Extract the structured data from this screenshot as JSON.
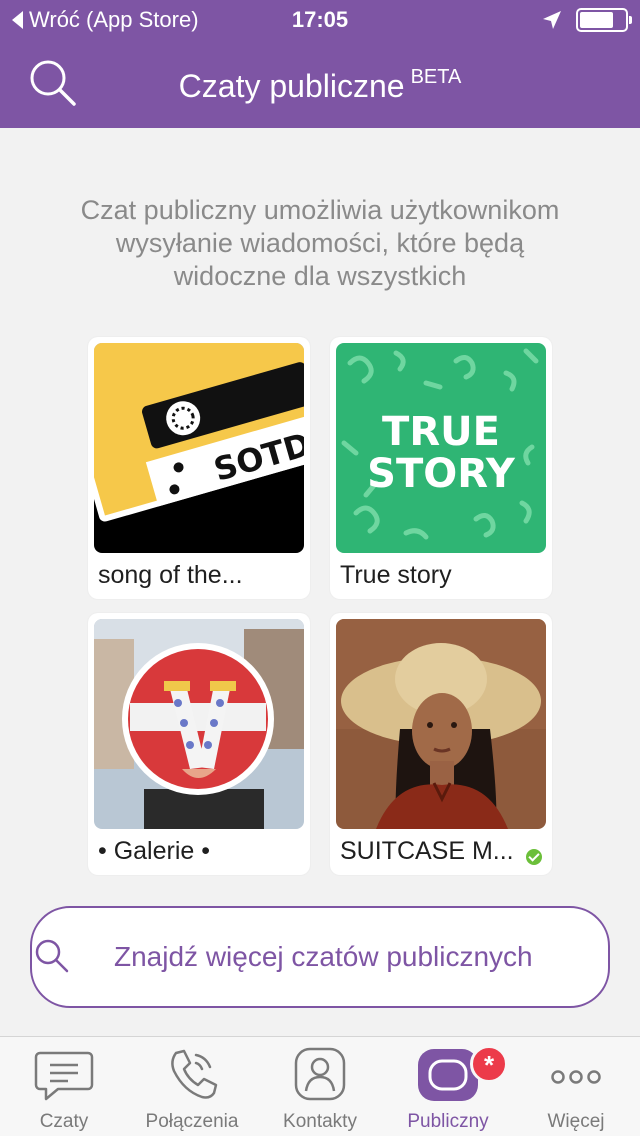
{
  "status": {
    "back_label": "Wróć (App Store)",
    "time": "17:05",
    "battery_level": 0.75
  },
  "header": {
    "title": "Czaty publiczne",
    "beta": "BETA"
  },
  "description": "Czat publiczny umożliwia użytkownikom wysyłanie wiadomości, które będą widoczne dla wszystkich",
  "cards": [
    {
      "label": "song of the...",
      "image_text": "SOTD",
      "verified": false
    },
    {
      "label": "True story",
      "image_text_1": "TRUE",
      "image_text_2": "STORY",
      "verified": false
    },
    {
      "label": "• Galerie •",
      "verified": false
    },
    {
      "label": "SUITCASE M...",
      "verified": true
    }
  ],
  "find_more": {
    "label": "Znajdź więcej czatów publicznych"
  },
  "tabs": [
    {
      "label": "Czaty",
      "icon": "chat-bubble-icon"
    },
    {
      "label": "Połączenia",
      "icon": "phone-icon"
    },
    {
      "label": "Kontakty",
      "icon": "contacts-icon"
    },
    {
      "label": "Publiczny",
      "icon": "public-chat-icon",
      "badge": "*"
    },
    {
      "label": "Więcej",
      "icon": "more-dots-icon"
    }
  ],
  "colors": {
    "brand": "#7e55a4",
    "badge": "#ec3b4a",
    "verified": "#6bbf3a"
  }
}
